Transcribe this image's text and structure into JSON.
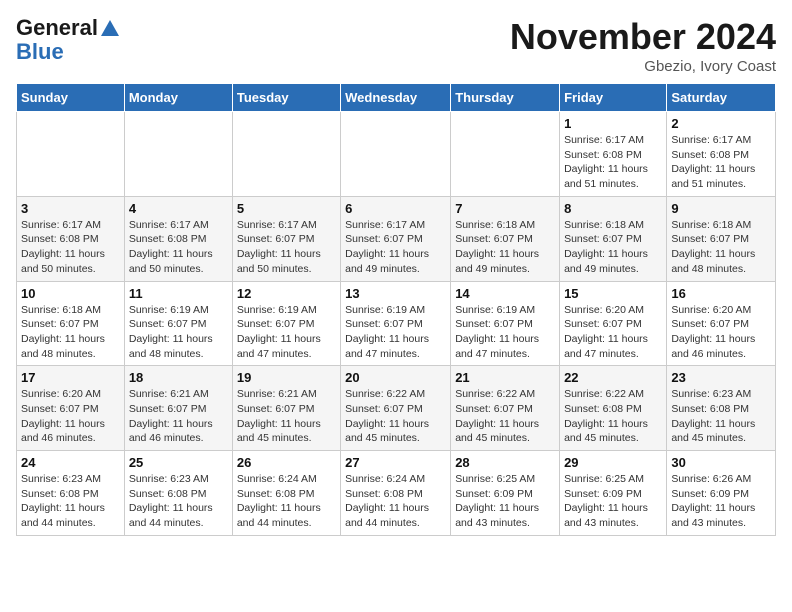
{
  "header": {
    "logo_line1": "General",
    "logo_line2": "Blue",
    "month_title": "November 2024",
    "location": "Gbezio, Ivory Coast"
  },
  "weekdays": [
    "Sunday",
    "Monday",
    "Tuesday",
    "Wednesday",
    "Thursday",
    "Friday",
    "Saturday"
  ],
  "weeks": [
    [
      {
        "day": "",
        "info": ""
      },
      {
        "day": "",
        "info": ""
      },
      {
        "day": "",
        "info": ""
      },
      {
        "day": "",
        "info": ""
      },
      {
        "day": "",
        "info": ""
      },
      {
        "day": "1",
        "info": "Sunrise: 6:17 AM\nSunset: 6:08 PM\nDaylight: 11 hours and 51 minutes."
      },
      {
        "day": "2",
        "info": "Sunrise: 6:17 AM\nSunset: 6:08 PM\nDaylight: 11 hours and 51 minutes."
      }
    ],
    [
      {
        "day": "3",
        "info": "Sunrise: 6:17 AM\nSunset: 6:08 PM\nDaylight: 11 hours and 50 minutes."
      },
      {
        "day": "4",
        "info": "Sunrise: 6:17 AM\nSunset: 6:08 PM\nDaylight: 11 hours and 50 minutes."
      },
      {
        "day": "5",
        "info": "Sunrise: 6:17 AM\nSunset: 6:07 PM\nDaylight: 11 hours and 50 minutes."
      },
      {
        "day": "6",
        "info": "Sunrise: 6:17 AM\nSunset: 6:07 PM\nDaylight: 11 hours and 49 minutes."
      },
      {
        "day": "7",
        "info": "Sunrise: 6:18 AM\nSunset: 6:07 PM\nDaylight: 11 hours and 49 minutes."
      },
      {
        "day": "8",
        "info": "Sunrise: 6:18 AM\nSunset: 6:07 PM\nDaylight: 11 hours and 49 minutes."
      },
      {
        "day": "9",
        "info": "Sunrise: 6:18 AM\nSunset: 6:07 PM\nDaylight: 11 hours and 48 minutes."
      }
    ],
    [
      {
        "day": "10",
        "info": "Sunrise: 6:18 AM\nSunset: 6:07 PM\nDaylight: 11 hours and 48 minutes."
      },
      {
        "day": "11",
        "info": "Sunrise: 6:19 AM\nSunset: 6:07 PM\nDaylight: 11 hours and 48 minutes."
      },
      {
        "day": "12",
        "info": "Sunrise: 6:19 AM\nSunset: 6:07 PM\nDaylight: 11 hours and 47 minutes."
      },
      {
        "day": "13",
        "info": "Sunrise: 6:19 AM\nSunset: 6:07 PM\nDaylight: 11 hours and 47 minutes."
      },
      {
        "day": "14",
        "info": "Sunrise: 6:19 AM\nSunset: 6:07 PM\nDaylight: 11 hours and 47 minutes."
      },
      {
        "day": "15",
        "info": "Sunrise: 6:20 AM\nSunset: 6:07 PM\nDaylight: 11 hours and 47 minutes."
      },
      {
        "day": "16",
        "info": "Sunrise: 6:20 AM\nSunset: 6:07 PM\nDaylight: 11 hours and 46 minutes."
      }
    ],
    [
      {
        "day": "17",
        "info": "Sunrise: 6:20 AM\nSunset: 6:07 PM\nDaylight: 11 hours and 46 minutes."
      },
      {
        "day": "18",
        "info": "Sunrise: 6:21 AM\nSunset: 6:07 PM\nDaylight: 11 hours and 46 minutes."
      },
      {
        "day": "19",
        "info": "Sunrise: 6:21 AM\nSunset: 6:07 PM\nDaylight: 11 hours and 45 minutes."
      },
      {
        "day": "20",
        "info": "Sunrise: 6:22 AM\nSunset: 6:07 PM\nDaylight: 11 hours and 45 minutes."
      },
      {
        "day": "21",
        "info": "Sunrise: 6:22 AM\nSunset: 6:07 PM\nDaylight: 11 hours and 45 minutes."
      },
      {
        "day": "22",
        "info": "Sunrise: 6:22 AM\nSunset: 6:08 PM\nDaylight: 11 hours and 45 minutes."
      },
      {
        "day": "23",
        "info": "Sunrise: 6:23 AM\nSunset: 6:08 PM\nDaylight: 11 hours and 45 minutes."
      }
    ],
    [
      {
        "day": "24",
        "info": "Sunrise: 6:23 AM\nSunset: 6:08 PM\nDaylight: 11 hours and 44 minutes."
      },
      {
        "day": "25",
        "info": "Sunrise: 6:23 AM\nSunset: 6:08 PM\nDaylight: 11 hours and 44 minutes."
      },
      {
        "day": "26",
        "info": "Sunrise: 6:24 AM\nSunset: 6:08 PM\nDaylight: 11 hours and 44 minutes."
      },
      {
        "day": "27",
        "info": "Sunrise: 6:24 AM\nSunset: 6:08 PM\nDaylight: 11 hours and 44 minutes."
      },
      {
        "day": "28",
        "info": "Sunrise: 6:25 AM\nSunset: 6:09 PM\nDaylight: 11 hours and 43 minutes."
      },
      {
        "day": "29",
        "info": "Sunrise: 6:25 AM\nSunset: 6:09 PM\nDaylight: 11 hours and 43 minutes."
      },
      {
        "day": "30",
        "info": "Sunrise: 6:26 AM\nSunset: 6:09 PM\nDaylight: 11 hours and 43 minutes."
      }
    ]
  ]
}
